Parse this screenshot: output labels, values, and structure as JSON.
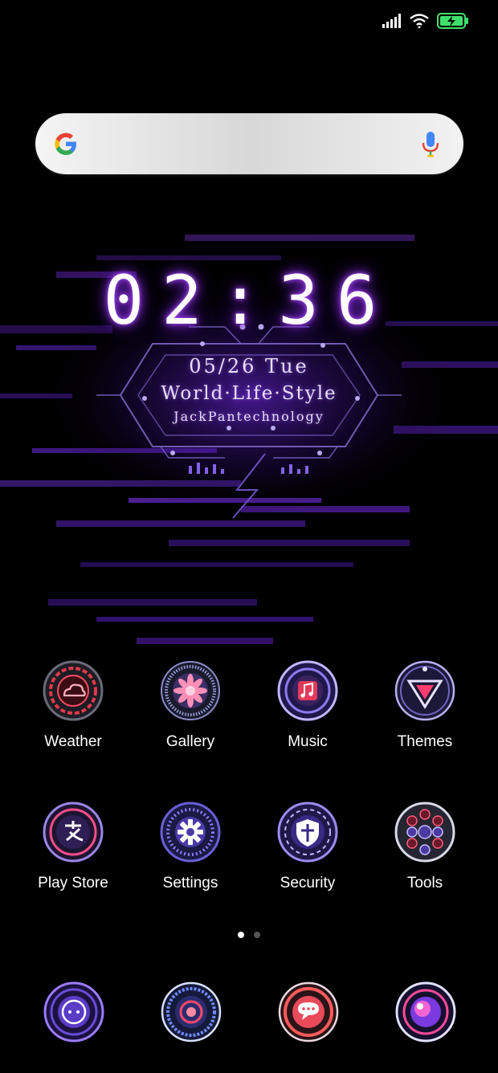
{
  "status_bar": {
    "signal": "signal-bars-icon",
    "wifi": "wifi-icon",
    "battery": "battery-charging-icon"
  },
  "search": {
    "logo": "google-logo-icon",
    "mic": "microphone-icon"
  },
  "clock_widget": {
    "time": "02:36",
    "date": "05/26 Tue",
    "tagline": "World·Life·Style",
    "brand": "JackPantechnology",
    "accent": "#9b4dff"
  },
  "apps": [
    {
      "label": "Weather",
      "icon": "weather-icon"
    },
    {
      "label": "Gallery",
      "icon": "gallery-icon"
    },
    {
      "label": "Music",
      "icon": "music-icon"
    },
    {
      "label": "Themes",
      "icon": "themes-icon"
    },
    {
      "label": "Play Store",
      "icon": "play-store-icon"
    },
    {
      "label": "Settings",
      "icon": "settings-icon"
    },
    {
      "label": "Security",
      "icon": "security-icon"
    },
    {
      "label": "Tools",
      "icon": "tools-icon"
    }
  ],
  "page_indicator": {
    "pages": 2,
    "current": 1
  },
  "dock": [
    {
      "icon": "phone-icon"
    },
    {
      "icon": "contacts-icon"
    },
    {
      "icon": "messaging-icon"
    },
    {
      "icon": "browser-icon"
    }
  ]
}
